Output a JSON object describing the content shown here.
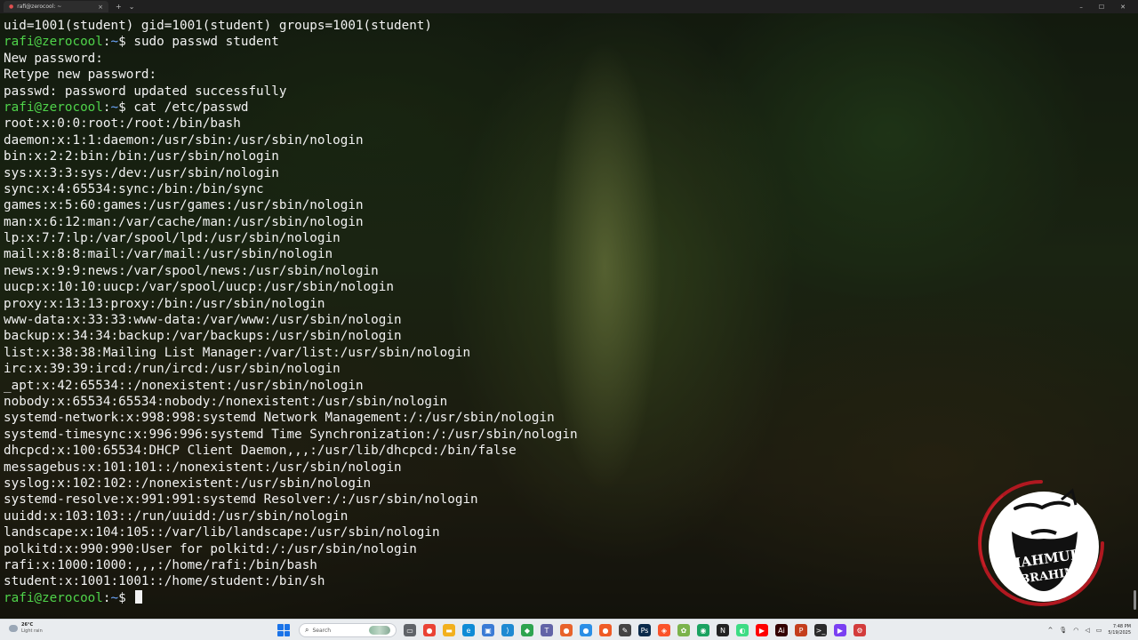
{
  "window": {
    "tab_title": "rafi@zerocool: ~",
    "tab_close": "×",
    "new_tab": "+",
    "dropdown": "⌄",
    "minimize": "–",
    "maximize": "☐",
    "close": "✕"
  },
  "terminal": {
    "prompt": {
      "user_host": "rafi@zerocool",
      "sep": ":",
      "path": "~",
      "symbol": "$"
    },
    "lines": [
      {
        "kind": "output",
        "text": "uid=1001(student) gid=1001(student) groups=1001(student)"
      },
      {
        "kind": "prompt",
        "text": " sudo passwd student"
      },
      {
        "kind": "output",
        "text": "New password:"
      },
      {
        "kind": "output",
        "text": "Retype new password:"
      },
      {
        "kind": "output",
        "text": "passwd: password updated successfully"
      },
      {
        "kind": "prompt",
        "text": " cat /etc/passwd"
      },
      {
        "kind": "output",
        "text": "root:x:0:0:root:/root:/bin/bash"
      },
      {
        "kind": "output",
        "text": "daemon:x:1:1:daemon:/usr/sbin:/usr/sbin/nologin"
      },
      {
        "kind": "output",
        "text": "bin:x:2:2:bin:/bin:/usr/sbin/nologin"
      },
      {
        "kind": "output",
        "text": "sys:x:3:3:sys:/dev:/usr/sbin/nologin"
      },
      {
        "kind": "output",
        "text": "sync:x:4:65534:sync:/bin:/bin/sync"
      },
      {
        "kind": "output",
        "text": "games:x:5:60:games:/usr/games:/usr/sbin/nologin"
      },
      {
        "kind": "output",
        "text": "man:x:6:12:man:/var/cache/man:/usr/sbin/nologin"
      },
      {
        "kind": "output",
        "text": "lp:x:7:7:lp:/var/spool/lpd:/usr/sbin/nologin"
      },
      {
        "kind": "output",
        "text": "mail:x:8:8:mail:/var/mail:/usr/sbin/nologin"
      },
      {
        "kind": "output",
        "text": "news:x:9:9:news:/var/spool/news:/usr/sbin/nologin"
      },
      {
        "kind": "output",
        "text": "uucp:x:10:10:uucp:/var/spool/uucp:/usr/sbin/nologin"
      },
      {
        "kind": "output",
        "text": "proxy:x:13:13:proxy:/bin:/usr/sbin/nologin"
      },
      {
        "kind": "output",
        "text": "www-data:x:33:33:www-data:/var/www:/usr/sbin/nologin"
      },
      {
        "kind": "output",
        "text": "backup:x:34:34:backup:/var/backups:/usr/sbin/nologin"
      },
      {
        "kind": "output",
        "text": "list:x:38:38:Mailing List Manager:/var/list:/usr/sbin/nologin"
      },
      {
        "kind": "output",
        "text": "irc:x:39:39:ircd:/run/ircd:/usr/sbin/nologin"
      },
      {
        "kind": "output",
        "text": "_apt:x:42:65534::/nonexistent:/usr/sbin/nologin"
      },
      {
        "kind": "output",
        "text": "nobody:x:65534:65534:nobody:/nonexistent:/usr/sbin/nologin"
      },
      {
        "kind": "output",
        "text": "systemd-network:x:998:998:systemd Network Management:/:/usr/sbin/nologin"
      },
      {
        "kind": "output",
        "text": "systemd-timesync:x:996:996:systemd Time Synchronization:/:/usr/sbin/nologin"
      },
      {
        "kind": "output",
        "text": "dhcpcd:x:100:65534:DHCP Client Daemon,,,:/usr/lib/dhcpcd:/bin/false"
      },
      {
        "kind": "output",
        "text": "messagebus:x:101:101::/nonexistent:/usr/sbin/nologin"
      },
      {
        "kind": "output",
        "text": "syslog:x:102:102::/nonexistent:/usr/sbin/nologin"
      },
      {
        "kind": "output",
        "text": "systemd-resolve:x:991:991:systemd Resolver:/:/usr/sbin/nologin"
      },
      {
        "kind": "output",
        "text": "uuidd:x:103:103::/run/uuidd:/usr/sbin/nologin"
      },
      {
        "kind": "output",
        "text": "landscape:x:104:105::/var/lib/landscape:/usr/sbin/nologin"
      },
      {
        "kind": "output",
        "text": "polkitd:x:990:990:User for polkitd:/:/usr/sbin/nologin"
      },
      {
        "kind": "output",
        "text": "rafi:x:1000:1000:,,,:/home/rafi:/bin/bash"
      },
      {
        "kind": "output",
        "text": "student:x:1001:1001::/home/student:/bin/sh"
      },
      {
        "kind": "prompt",
        "text": " "
      }
    ]
  },
  "watermark": {
    "line1": "MAHMUD",
    "line2": "IBRAHIM"
  },
  "taskbar": {
    "weather_temp": "26°C",
    "weather_desc": "Light rain",
    "search_glyph": "⌕",
    "search_placeholder": "Search",
    "tray_chevron": "^",
    "clock_time": "7:48 PM",
    "clock_date": "5/19/2025",
    "icons": [
      {
        "name": "task-view-icon",
        "glyph": "▭",
        "color": "#5f6368"
      },
      {
        "name": "chrome-icon",
        "glyph": "●",
        "color": "#ea4335"
      },
      {
        "name": "file-explorer-icon",
        "glyph": "▬",
        "color": "#f2b01e"
      },
      {
        "name": "edge-icon",
        "glyph": "e",
        "color": "#0f8bd6"
      },
      {
        "name": "store-icon",
        "glyph": "▣",
        "color": "#3a7bd5"
      },
      {
        "name": "vscode-icon",
        "glyph": "⟩",
        "color": "#1f8ad2"
      },
      {
        "name": "git-icon",
        "glyph": "◆",
        "color": "#2ea44f"
      },
      {
        "name": "teams-icon",
        "glyph": "T",
        "color": "#6264a7"
      },
      {
        "name": "firefox-icon",
        "glyph": "●",
        "color": "#e8632b"
      },
      {
        "name": "browser-blue-icon",
        "glyph": "●",
        "color": "#2b8fe6"
      },
      {
        "name": "postman-icon",
        "glyph": "●",
        "color": "#ef5b25"
      },
      {
        "name": "pen-tool-icon",
        "glyph": "✎",
        "color": "#444444"
      },
      {
        "name": "photoshop-icon",
        "glyph": "Ps",
        "color": "#0a2a4a"
      },
      {
        "name": "brave-icon",
        "glyph": "◈",
        "color": "#fb542b"
      },
      {
        "name": "paint-icon",
        "glyph": "✿",
        "color": "#7bb34b"
      },
      {
        "name": "vpn-icon",
        "glyph": "◉",
        "color": "#1aa260"
      },
      {
        "name": "notion-icon",
        "glyph": "N",
        "color": "#222222"
      },
      {
        "name": "android-icon",
        "glyph": "◐",
        "color": "#3ddc84"
      },
      {
        "name": "youtube-icon",
        "glyph": "▶",
        "color": "#ff0000"
      },
      {
        "name": "illustrator-icon",
        "glyph": "Ai",
        "color": "#330000"
      },
      {
        "name": "powerpoint-icon",
        "glyph": "P",
        "color": "#c43e1c"
      },
      {
        "name": "terminal-icon",
        "glyph": ">_",
        "color": "#2b2b2b"
      },
      {
        "name": "video-editor-icon",
        "glyph": "▶",
        "color": "#7a3ff2"
      },
      {
        "name": "settings-icon",
        "glyph": "⚙",
        "color": "#d33c3c"
      }
    ]
  }
}
